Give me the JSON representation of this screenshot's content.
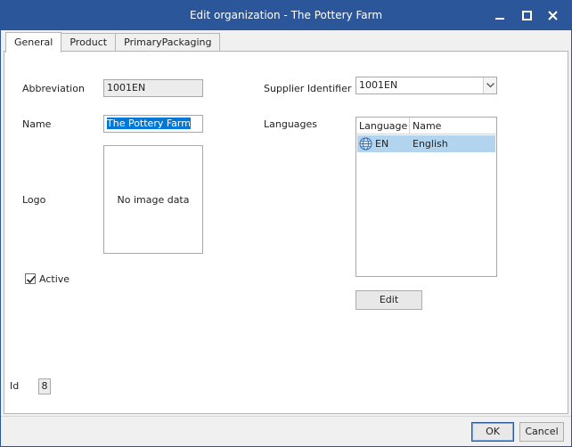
{
  "window": {
    "title": "Edit organization - The Pottery Farm"
  },
  "tabs": [
    {
      "label": "General",
      "active": true
    },
    {
      "label": "Product",
      "active": false
    },
    {
      "label": "PrimaryPackaging",
      "active": false
    }
  ],
  "general": {
    "abbreviation_label": "Abbreviation",
    "abbreviation_value": "1001EN",
    "name_label": "Name",
    "name_value": "The Pottery Farm",
    "logo_label": "Logo",
    "logo_placeholder": "No image data",
    "active_label": "Active",
    "active_checked": true,
    "supplier_label": "Supplier Identifier",
    "supplier_value": "1001EN",
    "languages_label": "Languages",
    "languages_columns": [
      "Language",
      "Name"
    ],
    "languages_rows": [
      {
        "code": "EN",
        "name": "English",
        "icon": "globe-icon",
        "selected": true
      }
    ],
    "edit_button": "Edit"
  },
  "id_label": "Id",
  "id_value": "8",
  "footer": {
    "ok_label": "OK",
    "cancel_label": "Cancel"
  },
  "colors": {
    "titlebar": "#2b579a",
    "selection": "#b3d4ee",
    "text_selection": "#0078d7"
  }
}
